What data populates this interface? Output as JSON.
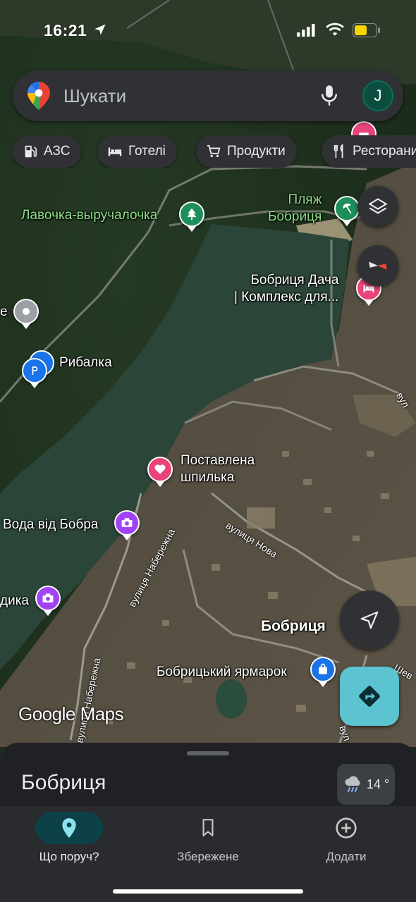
{
  "status_bar": {
    "time": "16:21"
  },
  "search": {
    "placeholder": "Шукати",
    "avatar_letter": "J"
  },
  "chips": [
    {
      "label": "АЗС",
      "icon": "gas-station-icon"
    },
    {
      "label": "Готелі",
      "icon": "hotel-bed-icon"
    },
    {
      "label": "Продукти",
      "icon": "shopping-cart-icon"
    },
    {
      "label": "Ресторани",
      "icon": "restaurant-icon"
    }
  ],
  "map": {
    "labels": {
      "lavochka": "Лавочка-выручалочка",
      "beach": "Пляж\nБобриця",
      "dacha": "Бобриця Дача\n| Комплекс для...",
      "rybalka": "Рибалка",
      "pin_dropped": "Поставлена\nшпилька",
      "voda": "Вода від Бобра",
      "dyka": "дика",
      "town": "Бобриця",
      "market": "Бобрицький ярмарок",
      "edge_e": "е"
    },
    "streets": {
      "naberezhna_1": "вулиця Набережна",
      "naberezhna_2": "вулиця Набережна",
      "nova": "вулиця Нова",
      "vul_edge": "вул",
      "shev_edge": "Шев",
      "vul_edge2": "вул"
    },
    "google_logo": "Google Maps"
  },
  "sheet": {
    "title": "Бобриця",
    "temperature": "14 °"
  },
  "nav": [
    {
      "label": "Що поруч?",
      "icon": "location-pin-icon",
      "active": true
    },
    {
      "label": "Збережене",
      "icon": "bookmark-icon",
      "active": false
    },
    {
      "label": "Додати",
      "icon": "add-circle-icon",
      "active": false
    }
  ],
  "colors": {
    "accent_teal": "#5cc3d1",
    "pin_green": "#1e8e5a",
    "pin_pink": "#e8447a",
    "pin_purple": "#a142f4",
    "pin_blue": "#1a73e8"
  }
}
